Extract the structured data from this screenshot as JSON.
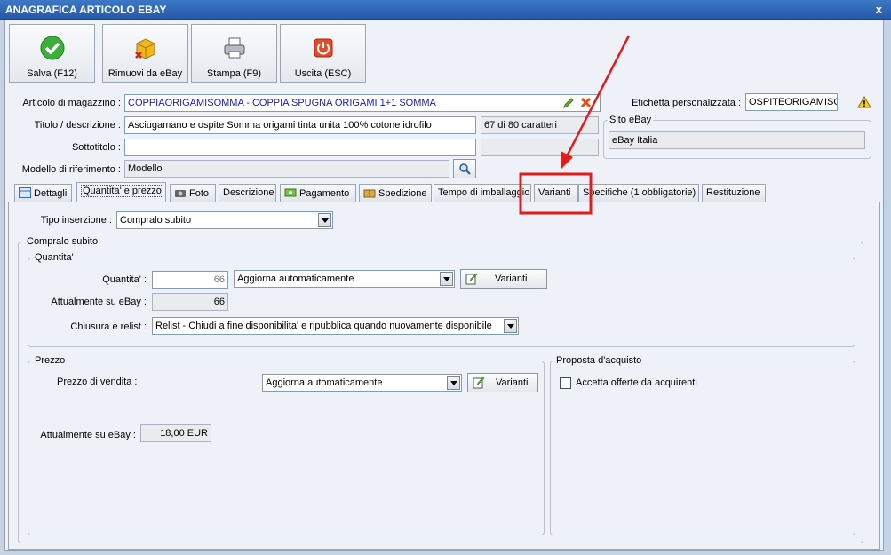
{
  "window": {
    "title": "ANAGRAFICA ARTICOLO EBAY",
    "close": "x"
  },
  "toolbar": {
    "save": "Salva (F12)",
    "remove": "Rimuovi da eBay",
    "print": "Stampa (F9)",
    "exit": "Uscita (ESC)"
  },
  "form": {
    "article_label": "Articolo di magazzino :",
    "article_value": "COPPIAORIGAMISOMMA -  COPPIA SPUGNA ORIGAMI 1+1 SOMMA",
    "title_label": "Titolo / descrizione :",
    "title_value": "Asciugamano e ospite Somma origami tinta unita 100% cotone idrofilo",
    "char_count": "67 di 80 caratteri",
    "subtitle_label": "Sottotitolo :",
    "subtitle_value": "",
    "model_label": "Modello di riferimento :",
    "model_value": "Modello",
    "custom_label_label": "Etichetta personalizzata :",
    "custom_label_value": "OSPITEORIGAMISOMMA",
    "site_group": "Sito eBay",
    "site_value": "eBay Italia"
  },
  "tabs": [
    {
      "label": "Dettagli"
    },
    {
      "label": "Quantita' e prezzo"
    },
    {
      "label": "Foto"
    },
    {
      "label": "Descrizione"
    },
    {
      "label": "Pagamento"
    },
    {
      "label": "Spedizione"
    },
    {
      "label": "Tempo di imballaggio"
    },
    {
      "label": "Varianti"
    },
    {
      "label": "Specifiche (1 obbligatorie)"
    },
    {
      "label": "Restituzione"
    }
  ],
  "panel": {
    "insertion_label": "Tipo inserzione :",
    "insertion_value": "Compralo subito",
    "buy_group": "Compralo subito",
    "qty_group": "Quantita'",
    "qty_label": "Quantita' :",
    "qty_value": "66",
    "qty_update": "Aggiorna automaticamente",
    "variants_btn": "Varianti",
    "qty_ebay_label": "Attualmente su eBay :",
    "qty_ebay_value": "66",
    "relist_label": "Chiusura e relist :",
    "relist_value": "Relist - Chiudi a fine disponibilita' e ripubblica quando nuovamente disponibile",
    "price_group": "Prezzo",
    "price_label": "Prezzo di vendita :",
    "price_update": "Aggiorna automaticamente",
    "price_variants_btn": "Varianti",
    "price_ebay_label": "Attualmente su eBay :",
    "price_ebay_value": "18,00 EUR",
    "offer_group": "Proposta d'acquisto",
    "offer_check": "Accetta offerte da acquirenti"
  },
  "colors": {
    "annotation": "#e31b1b",
    "titlebar": "#2f66b5",
    "link_text": "#1a1aa8"
  }
}
